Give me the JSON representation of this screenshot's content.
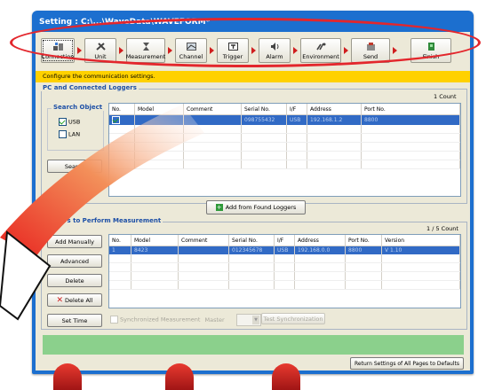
{
  "window": {
    "title": "Setting : C:\\...\\WaveData\\WAVEFORM*"
  },
  "toolbar": {
    "steps": [
      {
        "label": "Connection",
        "icon": "connection-icon"
      },
      {
        "label": "Unit",
        "icon": "unit-icon"
      },
      {
        "label": "Measurement",
        "icon": "hourglass-icon"
      },
      {
        "label": "Channel",
        "icon": "channel-icon"
      },
      {
        "label": "Trigger",
        "icon": "trigger-icon"
      },
      {
        "label": "Alarm",
        "icon": "alarm-icon"
      },
      {
        "label": "Environment",
        "icon": "environment-icon"
      },
      {
        "label": "Send",
        "icon": "send-icon"
      },
      {
        "label": "Finish",
        "icon": "finish-icon"
      }
    ]
  },
  "banner": {
    "text": "Configure the communication settings."
  },
  "pc_section": {
    "title": "PC and Connected Loggers",
    "count": "1 Count",
    "search_object": {
      "title": "Search Object",
      "usb_label": "USB",
      "usb_checked": true,
      "lan_label": "LAN",
      "lan_checked": false
    },
    "search_button": "Search",
    "columns": [
      "No.",
      "Model",
      "Comment",
      "Serial No.",
      "I/F",
      "Address",
      "Port No."
    ],
    "rows": [
      {
        "no": "",
        "model": "",
        "comment": "",
        "serial": "098755432",
        "if": "USB",
        "address": "192.168.1.2",
        "port": "8800"
      }
    ]
  },
  "add_button": {
    "label": "Add from Found Loggers"
  },
  "measure_section": {
    "title": "Loggers to Perform Measurement",
    "count": "1 / 5 Count",
    "columns": [
      "No.",
      "Model",
      "Comment",
      "Serial No.",
      "I/F",
      "Address",
      "Port No.",
      "Version"
    ],
    "rows": [
      {
        "no": "1",
        "model": "8423",
        "comment": "",
        "serial": "012345678",
        "if": "USB",
        "address": "192.168.0.0",
        "port": "8800",
        "version": "V 1.10"
      }
    ],
    "buttons": {
      "add_manually": "Add Manually",
      "advanced": "Advanced",
      "delete": "Delete",
      "delete_all": "Delete All",
      "set_time": "Set Time"
    },
    "sync": {
      "checkbox_label": "Synchronized Measurement",
      "master_label": "Master",
      "test_button": "Test Synchronization"
    }
  },
  "footer": {
    "return_button": "Return Settings of All Pages to Defaults"
  },
  "colors": {
    "accent_red": "#e3262c",
    "banner_yellow": "#ffd100",
    "selection_blue": "#316ac5",
    "title_blue": "#1c6fcf",
    "status_green": "#8bd08c"
  }
}
